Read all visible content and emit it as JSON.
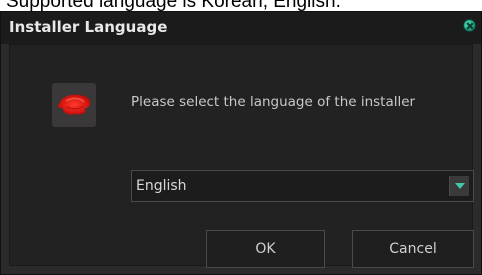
{
  "caption": "Supported language is Korean, English.",
  "window": {
    "title": "Installer Language",
    "close_icon": "close-icon"
  },
  "dialog": {
    "prompt": "Please select the language of the installer",
    "logo_icon": "red-swirl-logo-icon",
    "language_select": {
      "selected": "English"
    },
    "buttons": {
      "ok_label": "OK",
      "cancel_label": "Cancel"
    }
  },
  "colors": {
    "background": "#2b2b2b",
    "titlebar": "#1b1b1b",
    "accent": "#3fc9a8",
    "logo_red": "#e0201c"
  }
}
